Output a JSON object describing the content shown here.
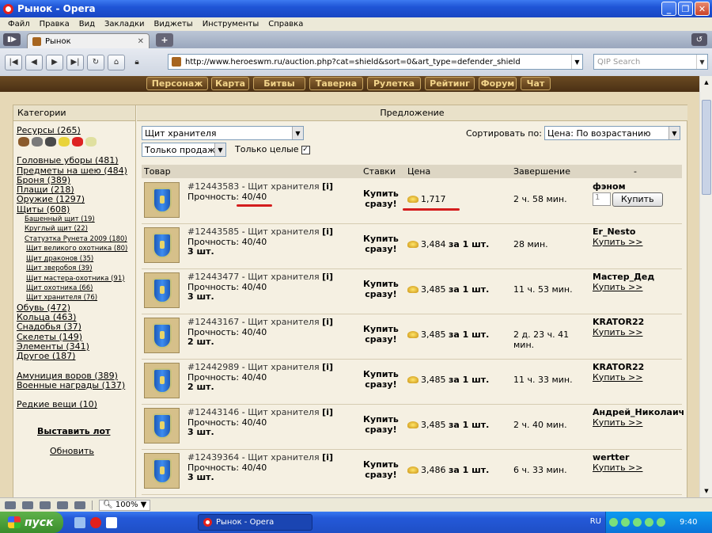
{
  "window": {
    "title": "Рынок - Opera"
  },
  "menu": [
    "Файл",
    "Правка",
    "Вид",
    "Закладки",
    "Виджеты",
    "Инструменты",
    "Справка"
  ],
  "tab": {
    "label": "Рынок"
  },
  "address": {
    "url": "http://www.heroeswm.ru/auction.php?cat=shield&sort=0&art_type=defender_shield",
    "search_placeholder": "QIP Search"
  },
  "game_nav": [
    "Персонаж",
    "Карта",
    "Битвы",
    "Таверна",
    "Рулетка",
    "Рейтинг",
    "Форум",
    "Чат"
  ],
  "categories": {
    "header": "Категории",
    "resources": "Ресурсы (265)",
    "groups1": [
      "Головные уборы (481)",
      "Предметы на шею (484)",
      "Броня (389)",
      "Плащи (218)",
      "Оружие (1297)",
      "Щиты (608)"
    ],
    "shields_sub": [
      "Башенный щит (19)",
      "Круглый щит (22)",
      "Статуэтка Рунета 2009 (180)"
    ],
    "shields_sub2": [
      "Щит великого охотника (80)",
      "Щит драконов (35)",
      "Щит зверобоя (39)",
      "Щит мастера-охотника (91)",
      "Щит охотника (66)",
      "Щит хранителя (76)"
    ],
    "groups2": [
      "Обувь (472)",
      "Кольца (463)",
      "Снадобья (37)",
      "Скелеты (149)",
      "Элементы (341)",
      "Другое (187)"
    ],
    "groups3": [
      "Амуниция воров (389)",
      "Военные награды (137)"
    ],
    "rare": "Редкие вещи (10)",
    "post_lot": "Выставить лот",
    "refresh": "Обновить"
  },
  "offers": {
    "header": "Предложение",
    "filter_item": "Щит хранителя",
    "filter_type": "Только продажа",
    "only_whole": "Только целые",
    "sort_label": "Сортировать по:",
    "sort_value": "Цена: По возрастанию",
    "columns": [
      "Товар",
      "Ставки",
      "Цена",
      "Завершение",
      "-"
    ],
    "buy_now": [
      "Купить",
      "сразу!"
    ],
    "per_unit": "за 1 шт.",
    "buy_link": "Купить >>",
    "buy_button": "Купить",
    "qty_value": "1",
    "rows": [
      {
        "lot": "#12443583",
        "name": "Щит хранителя",
        "info": "[i]",
        "durability_label": "Прочность:",
        "durability": "40/40",
        "qty": "",
        "price": "1,717",
        "per": false,
        "ends": "2 ч. 58 мин.",
        "seller": "фэном",
        "form": true
      },
      {
        "lot": "#12443585",
        "name": "Щит хранителя",
        "info": "[i]",
        "durability_label": "Прочность:",
        "durability": "40/40",
        "qty": "3 шт.",
        "price": "3,484",
        "per": true,
        "ends": "28 мин.",
        "seller": "Er_Nesto",
        "form": false
      },
      {
        "lot": "#12443477",
        "name": "Щит хранителя",
        "info": "[i]",
        "durability_label": "Прочность:",
        "durability": "40/40",
        "qty": "3 шт.",
        "price": "3,485",
        "per": true,
        "ends": "11 ч. 53 мин.",
        "seller": "Мастер_Дед",
        "form": false
      },
      {
        "lot": "#12443167",
        "name": "Щит хранителя",
        "info": "[i]",
        "durability_label": "Прочность:",
        "durability": "40/40",
        "qty": "2 шт.",
        "price": "3,485",
        "per": true,
        "ends": "2 д. 23 ч. 41 мин.",
        "seller": "KRATOR22",
        "form": false
      },
      {
        "lot": "#12442989",
        "name": "Щит хранителя",
        "info": "[i]",
        "durability_label": "Прочность:",
        "durability": "40/40",
        "qty": "2 шт.",
        "price": "3,485",
        "per": true,
        "ends": "11 ч. 33 мин.",
        "seller": "KRATOR22",
        "form": false
      },
      {
        "lot": "#12443146",
        "name": "Щит хранителя",
        "info": "[i]",
        "durability_label": "Прочность:",
        "durability": "40/40",
        "qty": "3 шт.",
        "price": "3,485",
        "per": true,
        "ends": "2 ч. 40 мин.",
        "seller": "Андрей_Николаич",
        "form": false
      },
      {
        "lot": "#12439364",
        "name": "Щит хранителя",
        "info": "[i]",
        "durability_label": "Прочность:",
        "durability": "40/40",
        "qty": "3 шт.",
        "price": "3,486",
        "per": true,
        "ends": "6 ч. 33 мин.",
        "seller": "wertter",
        "form": false
      }
    ]
  },
  "status": {
    "zoom": "100%"
  },
  "taskbar": {
    "start": "пуск",
    "task": "Рынок - Opera",
    "lang": "RU",
    "time": "9:40"
  },
  "colors": {
    "accent_red": "#d41d1d",
    "page_bg": "#e6d8b6",
    "nav_gold": "#f2d48a"
  }
}
